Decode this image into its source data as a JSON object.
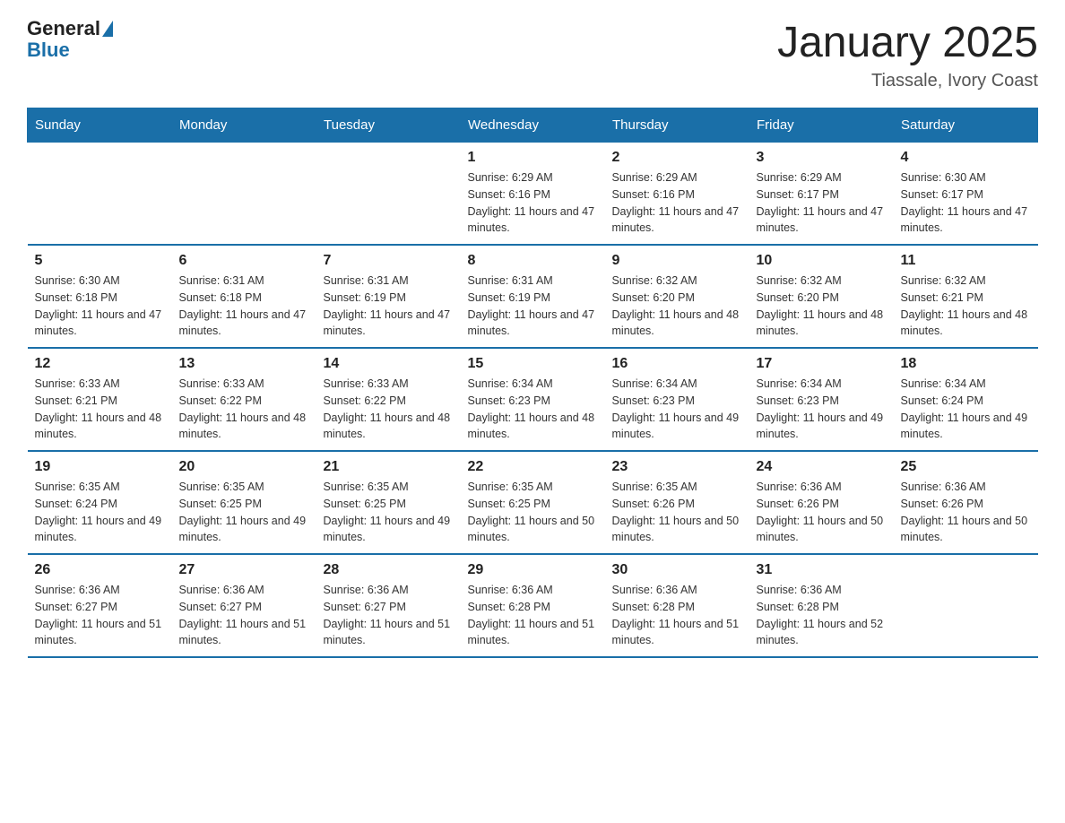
{
  "header": {
    "logo_general": "General",
    "logo_blue": "Blue",
    "title": "January 2025",
    "subtitle": "Tiassale, Ivory Coast"
  },
  "weekdays": [
    "Sunday",
    "Monday",
    "Tuesday",
    "Wednesday",
    "Thursday",
    "Friday",
    "Saturday"
  ],
  "weeks": [
    [
      {
        "day": "",
        "info": ""
      },
      {
        "day": "",
        "info": ""
      },
      {
        "day": "",
        "info": ""
      },
      {
        "day": "1",
        "info": "Sunrise: 6:29 AM\nSunset: 6:16 PM\nDaylight: 11 hours and 47 minutes."
      },
      {
        "day": "2",
        "info": "Sunrise: 6:29 AM\nSunset: 6:16 PM\nDaylight: 11 hours and 47 minutes."
      },
      {
        "day": "3",
        "info": "Sunrise: 6:29 AM\nSunset: 6:17 PM\nDaylight: 11 hours and 47 minutes."
      },
      {
        "day": "4",
        "info": "Sunrise: 6:30 AM\nSunset: 6:17 PM\nDaylight: 11 hours and 47 minutes."
      }
    ],
    [
      {
        "day": "5",
        "info": "Sunrise: 6:30 AM\nSunset: 6:18 PM\nDaylight: 11 hours and 47 minutes."
      },
      {
        "day": "6",
        "info": "Sunrise: 6:31 AM\nSunset: 6:18 PM\nDaylight: 11 hours and 47 minutes."
      },
      {
        "day": "7",
        "info": "Sunrise: 6:31 AM\nSunset: 6:19 PM\nDaylight: 11 hours and 47 minutes."
      },
      {
        "day": "8",
        "info": "Sunrise: 6:31 AM\nSunset: 6:19 PM\nDaylight: 11 hours and 47 minutes."
      },
      {
        "day": "9",
        "info": "Sunrise: 6:32 AM\nSunset: 6:20 PM\nDaylight: 11 hours and 48 minutes."
      },
      {
        "day": "10",
        "info": "Sunrise: 6:32 AM\nSunset: 6:20 PM\nDaylight: 11 hours and 48 minutes."
      },
      {
        "day": "11",
        "info": "Sunrise: 6:32 AM\nSunset: 6:21 PM\nDaylight: 11 hours and 48 minutes."
      }
    ],
    [
      {
        "day": "12",
        "info": "Sunrise: 6:33 AM\nSunset: 6:21 PM\nDaylight: 11 hours and 48 minutes."
      },
      {
        "day": "13",
        "info": "Sunrise: 6:33 AM\nSunset: 6:22 PM\nDaylight: 11 hours and 48 minutes."
      },
      {
        "day": "14",
        "info": "Sunrise: 6:33 AM\nSunset: 6:22 PM\nDaylight: 11 hours and 48 minutes."
      },
      {
        "day": "15",
        "info": "Sunrise: 6:34 AM\nSunset: 6:23 PM\nDaylight: 11 hours and 48 minutes."
      },
      {
        "day": "16",
        "info": "Sunrise: 6:34 AM\nSunset: 6:23 PM\nDaylight: 11 hours and 49 minutes."
      },
      {
        "day": "17",
        "info": "Sunrise: 6:34 AM\nSunset: 6:23 PM\nDaylight: 11 hours and 49 minutes."
      },
      {
        "day": "18",
        "info": "Sunrise: 6:34 AM\nSunset: 6:24 PM\nDaylight: 11 hours and 49 minutes."
      }
    ],
    [
      {
        "day": "19",
        "info": "Sunrise: 6:35 AM\nSunset: 6:24 PM\nDaylight: 11 hours and 49 minutes."
      },
      {
        "day": "20",
        "info": "Sunrise: 6:35 AM\nSunset: 6:25 PM\nDaylight: 11 hours and 49 minutes."
      },
      {
        "day": "21",
        "info": "Sunrise: 6:35 AM\nSunset: 6:25 PM\nDaylight: 11 hours and 49 minutes."
      },
      {
        "day": "22",
        "info": "Sunrise: 6:35 AM\nSunset: 6:25 PM\nDaylight: 11 hours and 50 minutes."
      },
      {
        "day": "23",
        "info": "Sunrise: 6:35 AM\nSunset: 6:26 PM\nDaylight: 11 hours and 50 minutes."
      },
      {
        "day": "24",
        "info": "Sunrise: 6:36 AM\nSunset: 6:26 PM\nDaylight: 11 hours and 50 minutes."
      },
      {
        "day": "25",
        "info": "Sunrise: 6:36 AM\nSunset: 6:26 PM\nDaylight: 11 hours and 50 minutes."
      }
    ],
    [
      {
        "day": "26",
        "info": "Sunrise: 6:36 AM\nSunset: 6:27 PM\nDaylight: 11 hours and 51 minutes."
      },
      {
        "day": "27",
        "info": "Sunrise: 6:36 AM\nSunset: 6:27 PM\nDaylight: 11 hours and 51 minutes."
      },
      {
        "day": "28",
        "info": "Sunrise: 6:36 AM\nSunset: 6:27 PM\nDaylight: 11 hours and 51 minutes."
      },
      {
        "day": "29",
        "info": "Sunrise: 6:36 AM\nSunset: 6:28 PM\nDaylight: 11 hours and 51 minutes."
      },
      {
        "day": "30",
        "info": "Sunrise: 6:36 AM\nSunset: 6:28 PM\nDaylight: 11 hours and 51 minutes."
      },
      {
        "day": "31",
        "info": "Sunrise: 6:36 AM\nSunset: 6:28 PM\nDaylight: 11 hours and 52 minutes."
      },
      {
        "day": "",
        "info": ""
      }
    ]
  ]
}
